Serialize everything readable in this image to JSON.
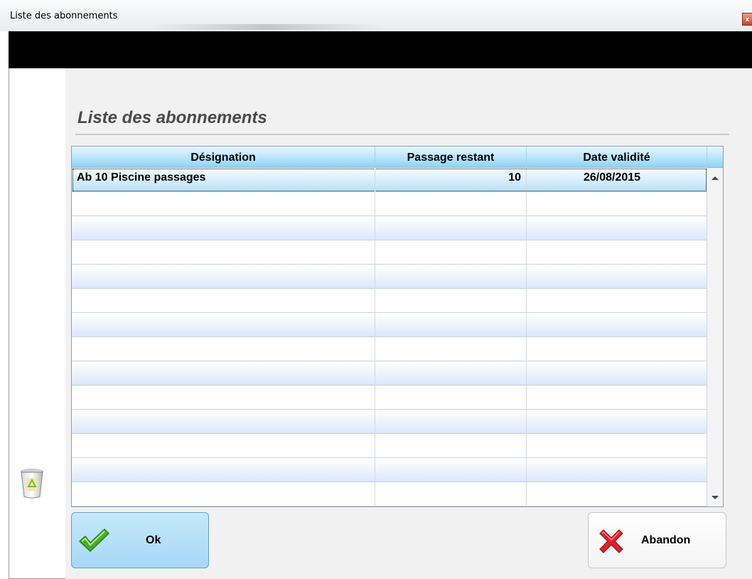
{
  "window": {
    "title": "Liste des abonnements",
    "close_glyph": "x"
  },
  "page": {
    "heading": "Liste des abonnements"
  },
  "grid": {
    "columns": [
      "Désignation",
      "Passage restant",
      "Date validité"
    ],
    "rows": [
      [
        "Ab 10 Piscine passages",
        "10",
        "26/08/2015"
      ],
      [
        "",
        "",
        ""
      ],
      [
        "",
        "",
        ""
      ],
      [
        "",
        "",
        ""
      ],
      [
        "",
        "",
        ""
      ],
      [
        "",
        "",
        ""
      ],
      [
        "",
        "",
        ""
      ],
      [
        "",
        "",
        ""
      ],
      [
        "",
        "",
        ""
      ],
      [
        "",
        "",
        ""
      ],
      [
        "",
        "",
        ""
      ],
      [
        "",
        "",
        ""
      ],
      [
        "",
        "",
        ""
      ],
      [
        "",
        "",
        ""
      ]
    ]
  },
  "buttons": {
    "ok_label": "Ok",
    "abandon_label": "Abandon"
  },
  "icons": {
    "ok": "checkmark-icon",
    "abandon": "red-cross-icon",
    "trash": "recycle-bin-icon"
  },
  "colors": {
    "header_blue": "#8fd2f2",
    "ok_button": "#a6d8f5",
    "check_green": "#43b02a",
    "cross_red": "#e0202a"
  }
}
